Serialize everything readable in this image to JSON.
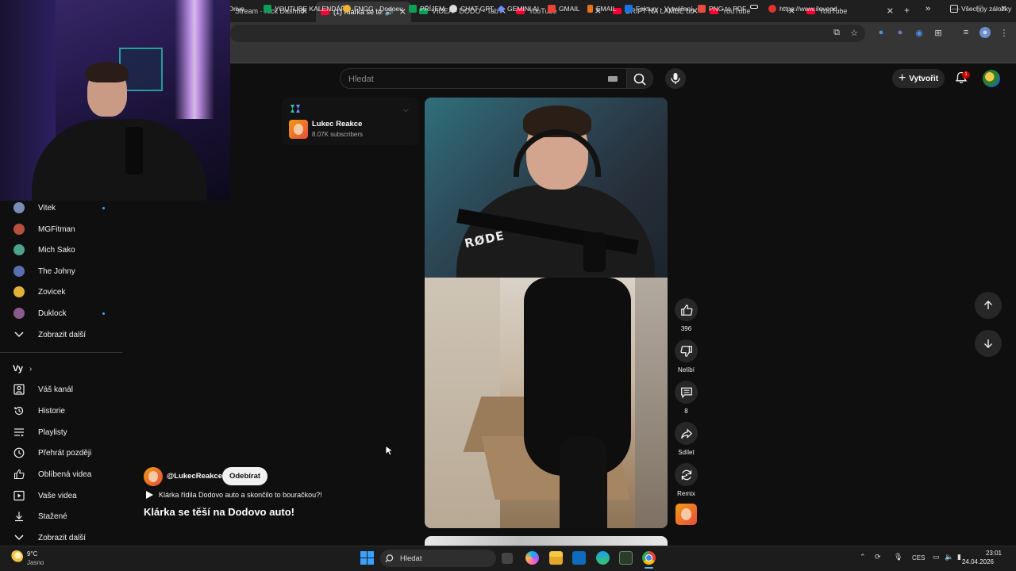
{
  "browser": {
    "tabs": [
      {
        "title": "Stream · Kick Dashbo",
        "favicon_color": "#1f1f1f",
        "active": false
      },
      {
        "title": "(1) Klárka se těší",
        "favicon_color": "#ff0033",
        "active": true
      },
      {
        "title": "VIDEA - DODO - Tab",
        "favicon_color": "#0f9d58",
        "active": false
      },
      {
        "title": "YouTube",
        "favicon_color": "#ff0033",
        "active": false
      },
      {
        "title": "DRIFT NA LAMBE bo",
        "favicon_color": "#ff0033",
        "active": false
      },
      {
        "title": "YouTube",
        "favicon_color": "#ff0033",
        "active": false
      },
      {
        "title": "YouTube",
        "favicon_color": "#ff0033",
        "active": false
      }
    ],
    "new_tab_symbol": "+",
    "bookmarks": [
      {
        "label": "Drive",
        "color": "#1e8e3e"
      },
      {
        "label": "YOUTUBE KALENDÁŘ",
        "color": "#0f9d58"
      },
      {
        "label": "FNGG - Dodoeu",
        "color": "#f2b134"
      },
      {
        "label": "PŘÍJEM",
        "color": "#0f9d58"
      },
      {
        "label": "CHAT GPT",
        "color": "#dddddd"
      },
      {
        "label": "GEMINI AI",
        "color": "#6c8cff"
      },
      {
        "label": "GMAIL",
        "color": "#ea4335"
      },
      {
        "label": "EMAIL",
        "color": "#e8711c"
      },
      {
        "label": "Faktury - Vytváření",
        "color": "#1a73e8"
      },
      {
        "label": "PNG to PDF",
        "color": "#e84c3d"
      },
      {
        "label": "",
        "color": "#eeeeee"
      },
      {
        "label": "https://www.ilovepd...",
        "color": "#e5322d"
      }
    ],
    "bookmarks_overflow": "»",
    "all_bookmarks": "Všechny záložky"
  },
  "youtube": {
    "search_placeholder": "Hledat",
    "create_label": "Vytvořit",
    "notification_count": "1",
    "sidebar": {
      "subscriptions": [
        {
          "name": "Vitek",
          "avatar_color": "#7a8cb5",
          "new": true
        },
        {
          "name": "MGFitman",
          "avatar_color": "#b5503c",
          "new": false
        },
        {
          "name": "Mich Sako",
          "avatar_color": "#4aa38a",
          "new": false
        },
        {
          "name": "The Johny",
          "avatar_color": "#5b6fb0",
          "new": false
        },
        {
          "name": "Zovicek",
          "avatar_color": "#e1b23a",
          "new": false
        },
        {
          "name": "Duklock",
          "avatar_color": "#8a5a8c",
          "new": true
        }
      ],
      "show_more_subs": "Zobrazit další",
      "you_label": "Vy",
      "you_items": [
        {
          "label": "Váš kanál",
          "icon": "user-box-icon"
        },
        {
          "label": "Historie",
          "icon": "history-icon"
        },
        {
          "label": "Playlisty",
          "icon": "playlist-icon"
        },
        {
          "label": "Přehrát později",
          "icon": "clock-icon"
        },
        {
          "label": "Oblíbená videa",
          "icon": "thumb-up-icon"
        },
        {
          "label": "Vaše videa",
          "icon": "video-icon"
        },
        {
          "label": "Stažené",
          "icon": "download-icon"
        }
      ],
      "show_more_you": "Zobrazit další"
    },
    "channel_card": {
      "name": "Lukec Reakce",
      "subscribers": "8.07K subscribers"
    },
    "short": {
      "handle": "@LukecReakce",
      "subscribe_label": "Odebírat",
      "sound_text": "Klárka řídila Dodovo auto a skončilo to bouračkou?!",
      "title": "Klárka se těší na Dodovo auto!",
      "watermark_text": "RØDE"
    },
    "actions": {
      "like_count": "396",
      "dislike_label": "Nelíbí",
      "comment_count": "8",
      "share_label": "Sdílet",
      "remix_label": "Remix"
    }
  },
  "taskbar": {
    "weather_temp": "9°C",
    "weather_desc": "Jasno",
    "search_label": "Hledat",
    "language": "CES",
    "time": "23:01",
    "date": "24.04.2026"
  }
}
